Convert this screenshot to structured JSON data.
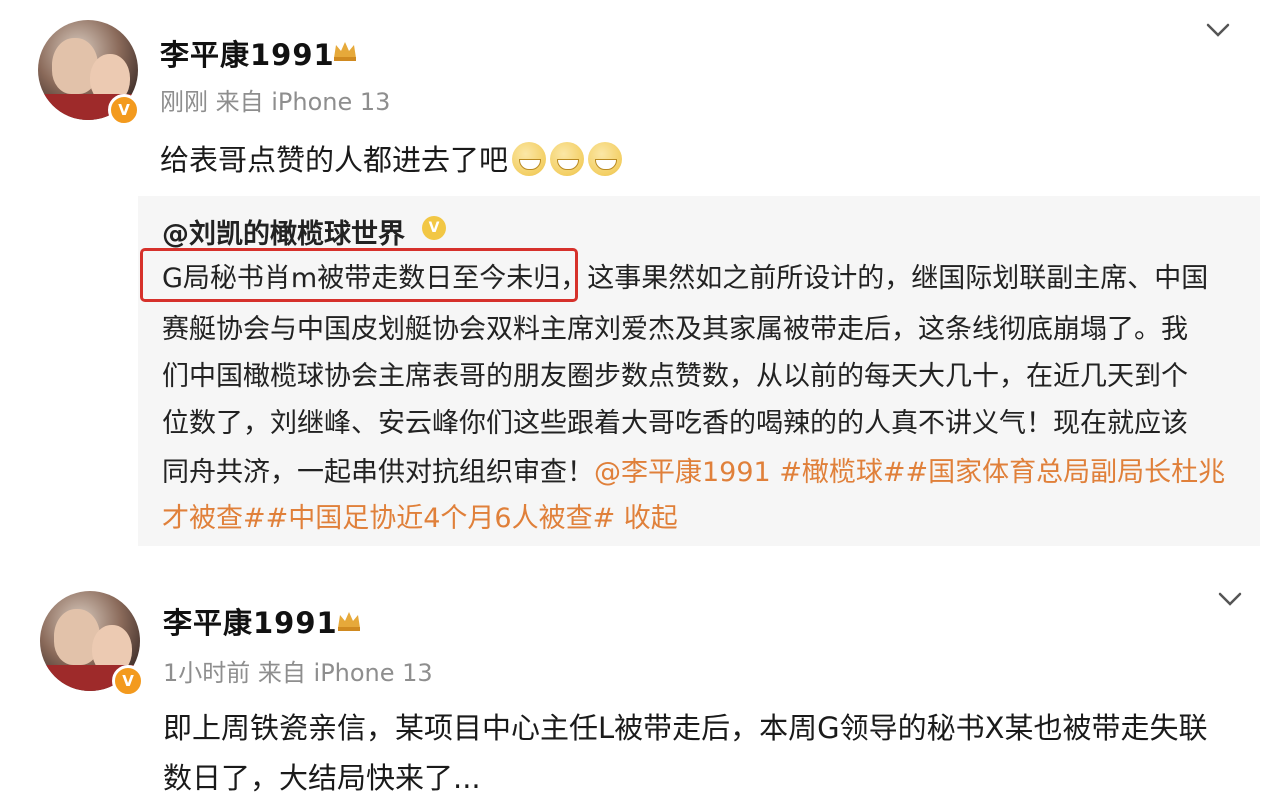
{
  "posts": [
    {
      "username": "李平康1991",
      "meta": "刚刚  来自 iPhone 13",
      "text": "给表哥点赞的人都进去了吧",
      "emoji_count": 3,
      "repost": {
        "author": "@刘凯的橄榄球世界",
        "highlight": "G局秘书肖m被带走数日至今未归",
        "line1_rest": "，这事果然如之前所设计的，继国际划联副主席、中国",
        "line2": "赛艇协会与中国皮划艇协会双料主席刘爱杰及其家属被带走后，这条线彻底崩塌了。我",
        "line3": "们中国橄榄球协会主席表哥的朋友圈步数点赞数，从以前的每天大几十，在近几天到个",
        "line4": "位数了，刘继峰、安云峰你们这些跟着大哥吃香的喝辣的的人真不讲义气！现在就应该",
        "line5_text": "同舟共济，一起串供对抗组织审查！",
        "line5_tags": "@李平康1991 #橄榄球##国家体育总局副局长杜兆",
        "line6_tags": "才被查##中国足协近4个月6人被查# 收起"
      }
    },
    {
      "username": "李平康1991",
      "meta": "1小时前  来自 iPhone 13",
      "text_line1": "即上周铁瓷亲信，某项目中心主任L被带走后，本周G领导的秘书X某也被带走失联",
      "text_line2": "数日了，大结局快来了..."
    }
  ],
  "colors": {
    "tag": "#e0803a",
    "highlight_border": "#d6312b",
    "verified_badge": "#f39a1e"
  },
  "icons": [
    "chevron-down-icon",
    "crown-icon",
    "verified-icon",
    "grin-emoji-icon"
  ]
}
